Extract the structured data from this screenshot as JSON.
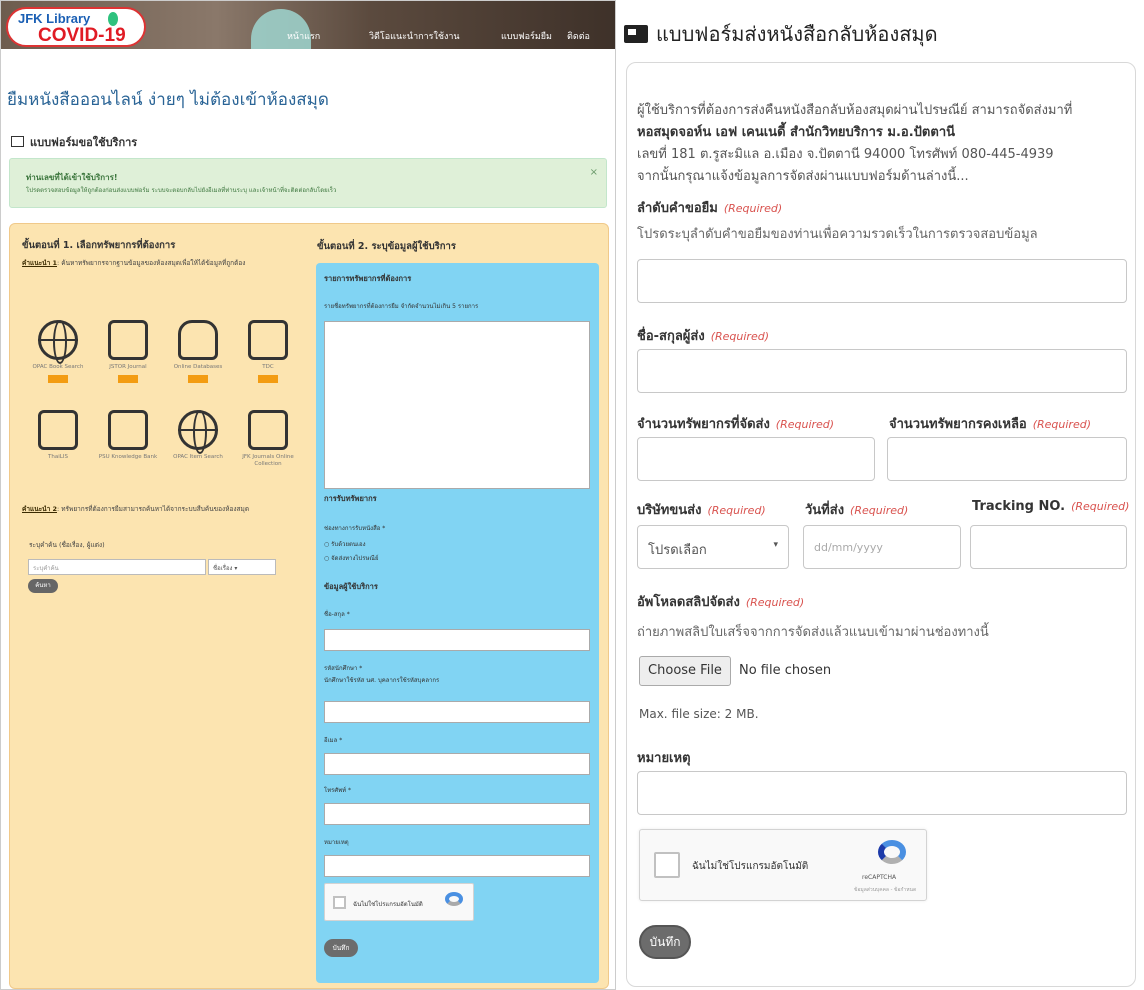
{
  "left": {
    "logo": {
      "line1": "JFK Library",
      "line2": "COVID-19"
    },
    "nav": [
      "หน้าแรก",
      "วิดีโอแนะนำการใช้งาน",
      "แบบฟอร์มยืม",
      "ติดต่อ"
    ],
    "page_title": "ยืมหนังสือออนไลน์ ง่ายๆ ไม่ต้องเข้าห้องสมุด",
    "form_title": "แบบฟอร์มขอใช้บริการ",
    "alert": {
      "title": "ท่านเลขที่ได้เข้าใช้บริการ!",
      "text": "โปรดตรวจสอบข้อมูลให้ถูกต้องก่อนส่งแบบฟอร์ม ระบบจะตอบกลับไปยังอีเมลที่ท่านระบุ และเจ้าหน้าที่จะติดต่อกลับโดยเร็ว",
      "close": "×"
    },
    "step1": {
      "heading": "ขั้นตอนที่ 1. เลือกทรัพยากรที่ต้องการ",
      "note1_label": "คำแนะนำ 1",
      "note1_text": ": ค้นหาทรัพยากรจากฐานข้อมูลของห้องสมุดเพื่อให้ได้ข้อมูลที่ถูกต้อง",
      "resources": [
        {
          "name": "OPAC Book Search",
          "icon": "globe-icon"
        },
        {
          "name": "JSTOR Journal",
          "icon": "tablet-icon"
        },
        {
          "name": "Online Databases",
          "icon": "database-icon"
        },
        {
          "name": "TDC",
          "icon": "document-icon"
        },
        {
          "name": "ThaiLIS",
          "icon": "book-icon"
        },
        {
          "name": "PSU Knowledge Bank",
          "icon": "reader-icon"
        },
        {
          "name": "OPAC Item Search",
          "icon": "globe-icon"
        },
        {
          "name": "JFK Journals Online Collection",
          "icon": "books-icon"
        }
      ],
      "note2_label": "คำแนะนำ 2",
      "note2_text": ": ทรัพยากรที่ต้องการยืมสามารถค้นหาได้จากระบบสืบค้นของห้องสมุด",
      "search_label": "ระบุคำค้น (ชื่อเรื่อง, ผู้แต่ง)",
      "search_placeholder": "ระบุคำค้น",
      "search_select": "ชื่อเรื่อง",
      "search_button": "ค้นหา"
    },
    "step2": {
      "heading": "ขั้นตอนที่ 2. ระบุข้อมูลผู้ใช้บริการ",
      "section1": "รายการทรัพยากรที่ต้องการ",
      "section1_hint": "รายชื่อทรัพยากรที่ต้องการยืม จำกัดจำนวนไม่เกิน 5 รายการ",
      "section2": "การรับทรัพยากร",
      "delivery_label": "ช่องทางการรับหนังสือ *",
      "delivery_opt1": "รับด้วยตนเอง",
      "delivery_opt2": "จัดส่งทางไปรษณีย์",
      "section3": "ข้อมูลผู้ใช้บริการ",
      "name_label": "ชื่อ-สกุล *",
      "id_label": "รหัสนักศึกษา *",
      "id_hint": "นักศึกษาใช้รหัส นศ. บุคลากรใช้รหัสบุคลากร",
      "email_label": "อีเมล *",
      "phone_label": "โทรศัพท์ *",
      "note_label": "หมายเหตุ",
      "captcha_text": "ฉันไม่ใช่โปรแกรมอัตโนมัติ",
      "save_button": "บันทึก"
    }
  },
  "right": {
    "title": "แบบฟอร์มส่งหนังสือกลับห้องสมุด",
    "intro": [
      "ผู้ใช้บริการที่ต้องการส่งคืนหนังสือกลับห้องสมุดผ่านไปรษณีย์ สามารถจัดส่งมาที่",
      "หอสมุดจอห์น เอฟ เคนเนดี้ สำนักวิทยบริการ ม.อ.ปัตตานี",
      "เลขที่ 181 ต.รูสะมิแล อ.เมือง จ.ปัตตานี 94000 โทรศัพท์ 080-445-4939",
      "จากนั้นกรุณาแจ้งข้อมูลการจัดส่งผ่านแบบฟอร์มด้านล่างนี้..."
    ],
    "required": "(Required)",
    "fields": {
      "order_label": "ลำดับคำขอยืม",
      "order_help": "โปรดระบุลำดับคำขอยืมของท่านเพื่อความรวดเร็วในการตรวจสอบข้อมูล",
      "sender_label": "ชื่อ-สกุลผู้ส่ง",
      "sent_count_label": "จำนวนทรัพยากรที่จัดส่ง",
      "remain_count_label": "จำนวนทรัพยากรคงเหลือ",
      "carrier_label": "บริษัทขนส่ง",
      "carrier_value": "โปรดเลือก",
      "date_label": "วันที่ส่ง",
      "date_placeholder": "dd/mm/yyyy",
      "tracking_label": "Tracking NO.",
      "upload_label": "อัพโหลดสลิปจัดส่ง",
      "upload_help": "ถ่ายภาพสลิปใบเสร็จจากการจัดส่งแล้วแนบเข้ามาผ่านช่องทางนี้",
      "choose_file": "Choose File",
      "no_file": "No file chosen",
      "max_size": "Max. file size: 2 MB.",
      "note_label": "หมายเหตุ"
    },
    "captcha": {
      "text": "ฉันไม่ใช่โปรแกรมอัตโนมัติ",
      "brand": "reCAPTCHA",
      "links": "ข้อมูลส่วนบุคคล - ข้อกำหนด"
    },
    "save_button": "บันทึก"
  }
}
